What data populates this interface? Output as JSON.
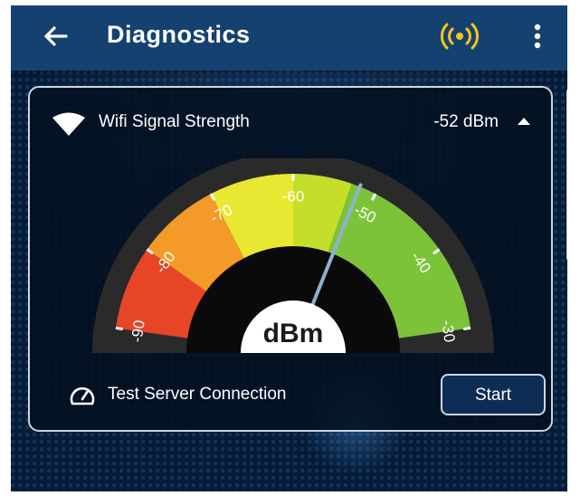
{
  "app_bar": {
    "title": "Diagnostics",
    "back_icon": "arrow-left-icon",
    "signal_icon": "broadcast-icon",
    "signal_icon_color": "#f5c518",
    "menu_icon": "more-vertical-icon"
  },
  "signal_card": {
    "label": "Wifi Signal Strength",
    "value": "-52 dBm",
    "current_dbm": -52,
    "wifi_icon": "wifi-icon",
    "collapse_icon": "chevron-up-icon",
    "gauge": {
      "min": -90,
      "max": -30,
      "unit_label": "dBm",
      "tick_labels": [
        "-90",
        "-80",
        "-70",
        "-60",
        "-50",
        "-40",
        "-30"
      ],
      "zones": [
        {
          "from": -90,
          "to": -80,
          "color": "#e84428"
        },
        {
          "from": -80,
          "to": -70,
          "color": "#f39a28"
        },
        {
          "from": -70,
          "to": -60,
          "color": "#e8e832"
        },
        {
          "from": -60,
          "to": -53,
          "color": "#c5de2a"
        },
        {
          "from": -53,
          "to": -30,
          "color": "#7cc33a"
        }
      ],
      "needle_color": "#8fb0d4"
    }
  },
  "test_connection": {
    "icon": "speedometer-icon",
    "label": "Test Server Connection",
    "button_label": "Start"
  }
}
